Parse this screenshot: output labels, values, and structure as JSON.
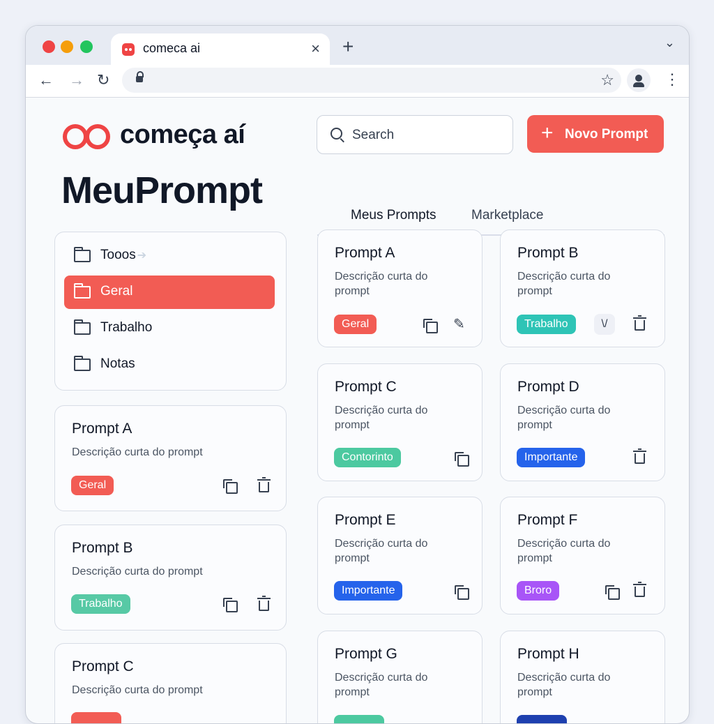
{
  "browser": {
    "tab_title": "comeca ai",
    "tab_close": "×",
    "new_tab": "+",
    "tabs_menu": "⌄",
    "back": "←",
    "forward": "→",
    "reload": "↻",
    "star": "☆",
    "menu": "⋮"
  },
  "logo": {
    "text": "começa aí"
  },
  "page_title": "MeuPrompt",
  "search": {
    "placeholder": "Search"
  },
  "new_prompt_button": {
    "icon": "+",
    "label": "Novo Prompt"
  },
  "main_tabs": [
    {
      "label": "Meus Prompts",
      "active": true
    },
    {
      "label": "Marketplace",
      "active": false
    }
  ],
  "folders": [
    {
      "label": "Tooos",
      "hint": "➔",
      "active": false
    },
    {
      "label": "Geral",
      "active": true
    },
    {
      "label": "Trabalho",
      "active": false
    },
    {
      "label": "Notas",
      "active": false
    }
  ],
  "tag_colors": {
    "Geral": "#f25c54",
    "Trabalho": "#2ec4b6",
    "Contorinto": "#4cc9a0",
    "Importante": "#2563eb",
    "Broro": "#a855f7"
  },
  "left_list": [
    {
      "title": "Prompt A",
      "desc": "Descrição curta do prompt",
      "tag": "Geral",
      "tag_color": "#f25c54"
    },
    {
      "title": "Prompt B",
      "desc": "Descrição curta do prompt",
      "tag": "Trabalho",
      "tag_color": "#57c9a5"
    },
    {
      "title": "Prompt C",
      "desc": "Descrição curta do prompt"
    }
  ],
  "grid": [
    {
      "title": "Prompt A",
      "desc": "Descrição curta do prompt",
      "tag": "Geral",
      "tag_color": "#f25c54",
      "actions": [
        "copy-icon",
        "pencil-icon"
      ]
    },
    {
      "title": "Prompt B",
      "desc": "Descrição curta do prompt",
      "tag": "Trabalho",
      "tag_color": "#2ec4b6",
      "actions": [
        "check-icon",
        "trash-icon"
      ],
      "check_glyph": "\\/"
    },
    {
      "title": "Prompt C",
      "desc": "Descrição curta do prompt",
      "tag": "Contorinto",
      "tag_color": "#4cc9a0",
      "actions": [
        "copy-icon"
      ]
    },
    {
      "title": "Prompt D",
      "desc": "Descrição curta do prompt",
      "tag": "Importante",
      "tag_color": "#2563eb",
      "actions": [
        "trash-icon"
      ]
    },
    {
      "title": "Prompt E",
      "desc": "Descrição curta do prompt",
      "tag": "Importante",
      "tag_color": "#2563eb",
      "actions": [
        "copy-icon"
      ]
    },
    {
      "title": "Prompt F",
      "desc": "Descrição curta do prompt",
      "tag": "Broro",
      "tag_color": "#a855f7",
      "actions": [
        "copy-icon",
        "trash-icon"
      ]
    },
    {
      "title": "Prompt G",
      "desc": "Descrição curta do prompt"
    },
    {
      "title": "Prompt H",
      "desc": "Descrição curta do prompt"
    }
  ],
  "edit_glyph": "✎"
}
